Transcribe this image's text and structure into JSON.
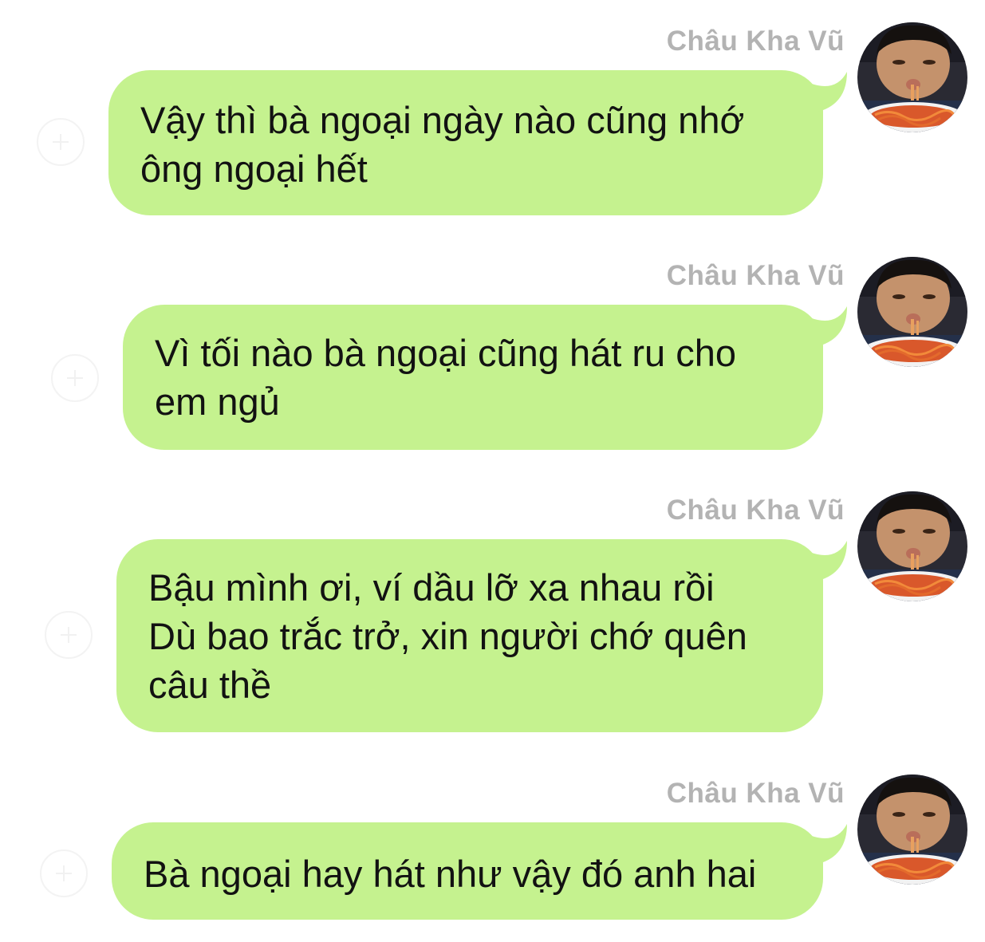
{
  "chat": {
    "bubble_color": "#c5f28f",
    "messages": [
      {
        "sender": "Châu Kha Vũ",
        "text": "Vậy thì bà ngoại ngày nào cũng nhớ\nông ngoại hết",
        "avatar_icon": "avatar-photo-icon",
        "reaction_icon": "add-reaction-icon"
      },
      {
        "sender": "Châu Kha Vũ",
        "text": "Vì tối nào bà ngoại cũng hát ru cho\nem ngủ",
        "avatar_icon": "avatar-photo-icon",
        "reaction_icon": "add-reaction-icon"
      },
      {
        "sender": "Châu Kha Vũ",
        "text": "Bậu mình ơi, ví dầu lỡ xa nhau rồi\nDù bao trắc trở, xin người chớ quên\ncâu thề",
        "avatar_icon": "avatar-photo-icon",
        "reaction_icon": "add-reaction-icon"
      },
      {
        "sender": "Châu Kha Vũ",
        "text": "Bà ngoại hay hát như vậy đó anh hai",
        "avatar_icon": "avatar-photo-icon",
        "reaction_icon": "add-reaction-icon"
      }
    ]
  }
}
